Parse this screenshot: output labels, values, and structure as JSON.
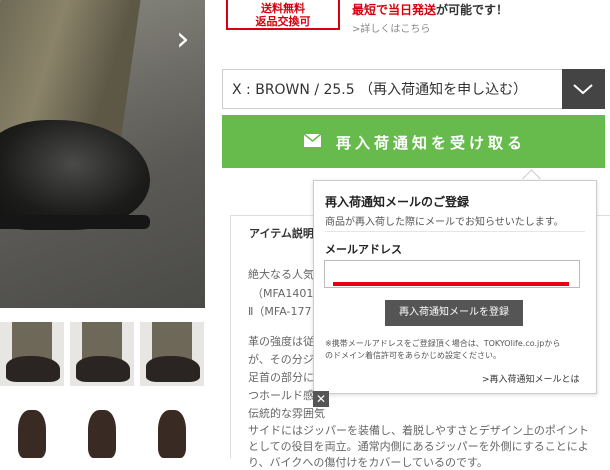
{
  "shipping": {
    "box_line1": "送料無料",
    "box_line2": "返品交換可",
    "text_prefix": "最短で当日発送",
    "text_suffix": "が可能です！",
    "link": ">詳しくはこちら"
  },
  "variant_select": {
    "value": "X : BROWN / 25.5 （再入荷通知を申し込む）"
  },
  "restock_button": {
    "label": "再入荷通知を受け取る",
    "icon": "mail-icon"
  },
  "description": {
    "tab": "アイテム説明",
    "lines": [
      "絶大なる人気を",
      "（MFA1401）",
      "Ⅱ（MFA-177",
      "革の強度は従来",
      "が、その分ジ",
      "足首の部分に",
      "つホールド感",
      "伝統的な雰囲気",
      "サイドにはジッパーを装備し、着脱しやすさとデザイン上のポイント",
      "としての役目を両立。通常内側にあるジッパーを外側にすることによ",
      "り、バイクへの傷付けをカバーしているのです。"
    ]
  },
  "popup": {
    "title": "再入荷通知メールのご登録",
    "subtitle": "商品が再入荷した際にメールでお知らせいたします。",
    "email_label": "メールアドレス",
    "email_value": "",
    "submit": "再入荷通知メールを登録",
    "note_line1": "※携帯メールアドレスをご登録頂く場合は、TOKYOlife.co.jpから",
    "note_line2": "のドメイン着信許可をあらかじめ設定ください。",
    "help_link": ">再入荷通知メールとは",
    "close": "✕"
  },
  "colors": {
    "accent_green": "#66bb4c",
    "alert_red": "#d7000f"
  }
}
